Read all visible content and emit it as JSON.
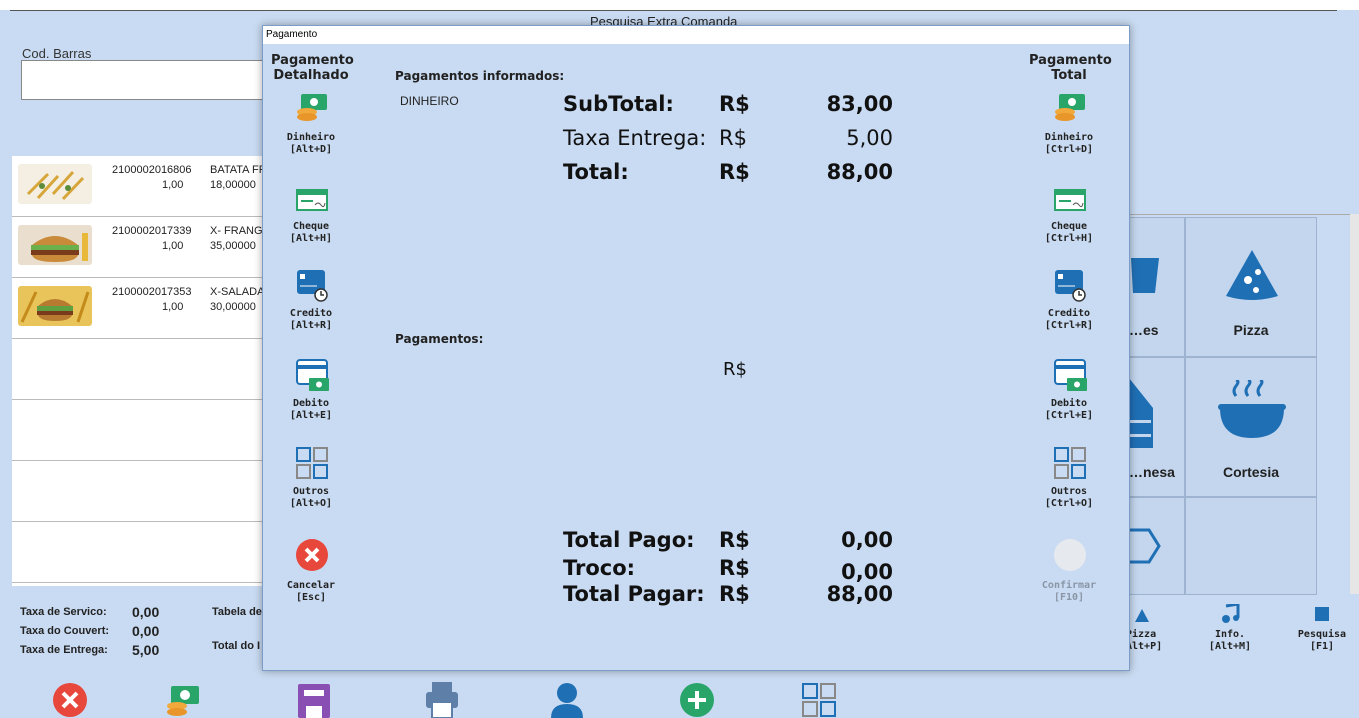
{
  "background": {
    "partial_title": "Pesquisa Extra Comanda",
    "cod_barras_label": "Cod. Barras",
    "items": [
      {
        "code": "2100002016806",
        "qty": "1,00",
        "name": "BATATA FRITA",
        "price": "18,00000"
      },
      {
        "code": "2100002017339",
        "qty": "1,00",
        "name": "X- FRANGO",
        "price": "35,00000"
      },
      {
        "code": "2100002017353",
        "qty": "1,00",
        "name": "X-SALADA",
        "price": "30,00000"
      }
    ],
    "totals": {
      "taxa_servico_label": "Taxa de Servico:",
      "taxa_servico": "0,00",
      "taxa_couvert_label": "Taxa do Couvert:",
      "taxa_couvert": "0,00",
      "taxa_entrega_label": "Taxa de Entrega:",
      "taxa_entrega": "5,00",
      "tabela_label": "Tabela de",
      "total_label": "Total do I"
    },
    "categories": [
      {
        "label": "Pizza",
        "icon": "pizza-icon"
      },
      {
        "label": "Cortesia",
        "icon": "soup-icon"
      },
      {
        "label": "…es",
        "icon": "drink-icon"
      },
      {
        "label": "…nesa",
        "icon": "box-icon"
      }
    ],
    "shortcuts": [
      {
        "label": "Pizza",
        "key": "Alt+P]",
        "icon": "pizza-small-icon"
      },
      {
        "label": "Info.",
        "key": "[Alt+M]",
        "icon": "music-icon"
      },
      {
        "label": "Pesquisa",
        "key": "[F1]",
        "icon": "stop-icon"
      }
    ]
  },
  "modal": {
    "title": "Pagamento",
    "left_header": "Pagamento\nDetalhado",
    "right_header": "Pagamento\nTotal",
    "left_buttons": [
      {
        "label": "Dinheiro",
        "key": "[Alt+D]",
        "icon": "cash-icon"
      },
      {
        "label": "Cheque",
        "key": "[Alt+H]",
        "icon": "cheque-icon"
      },
      {
        "label": "Credito",
        "key": "[Alt+R]",
        "icon": "credit-card-icon"
      },
      {
        "label": "Debito",
        "key": "[Alt+E]",
        "icon": "debit-card-icon"
      },
      {
        "label": "Outros",
        "key": "[Alt+O]",
        "icon": "grid-icon"
      },
      {
        "label": "Cancelar",
        "key": "[Esc]",
        "icon": "cancel-icon"
      }
    ],
    "right_buttons": [
      {
        "label": "Dinheiro",
        "key": "[Ctrl+D]",
        "icon": "cash-icon"
      },
      {
        "label": "Cheque",
        "key": "[Ctrl+H]",
        "icon": "cheque-icon"
      },
      {
        "label": "Credito",
        "key": "[Ctrl+R]",
        "icon": "credit-card-icon"
      },
      {
        "label": "Debito",
        "key": "[Ctrl+E]",
        "icon": "debit-card-icon"
      },
      {
        "label": "Outros",
        "key": "[Ctrl+O]",
        "icon": "grid-icon"
      },
      {
        "label": "Confirmar",
        "key": "[F10]",
        "icon": "confirm-icon"
      }
    ],
    "pagamentos_informados_label": "Pagamentos informados:",
    "payment_method": "DINHEIRO",
    "subtotal_label": "SubTotal:",
    "subtotal_cur": "R$",
    "subtotal": "83,00",
    "taxa_label": "Taxa Entrega:",
    "taxa_cur": "R$",
    "taxa": "5,00",
    "total_label": "Total:",
    "total_cur": "R$",
    "total": "88,00",
    "pagamentos_label": "Pagamentos:",
    "pagamentos_cur": "R$",
    "total_pago_label": "Total Pago:",
    "total_pago_cur": "R$",
    "total_pago": "0,00",
    "troco_label": "Troco:",
    "troco_cur": "R$",
    "troco": "0,00",
    "total_pagar_label": "Total Pagar:",
    "total_pagar_cur": "R$",
    "total_pagar": "88,00"
  },
  "colors": {
    "background": "#c9dbf2",
    "accent_blue": "#1f6fb5",
    "cancel_red": "#e8473c",
    "confirm_disabled": "#e6e9ee",
    "cash_green": "#2aa56a"
  }
}
